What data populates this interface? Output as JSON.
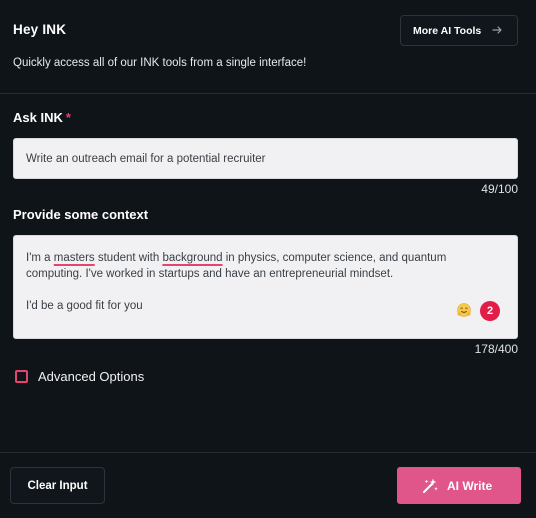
{
  "header": {
    "title": "Hey INK",
    "subtitle": "Quickly access all of our INK tools from a single interface!",
    "more_tools_label": "More AI Tools"
  },
  "ask": {
    "label": "Ask INK",
    "required_marker": "*",
    "value": "Write an outreach email for a potential recruiter",
    "count": "49/100"
  },
  "context": {
    "label": "Provide some context",
    "line1_a": "I'm a ",
    "line1_word1": "masters",
    "line1_b": " student with ",
    "line1_word2": "background",
    "line1_c": " in physics, computer science, and quantum computing. I've worked in startups and have an entrepreneurial mindset.",
    "line2": "I'd be a good fit for you",
    "grammar_issue_count": "2",
    "count": "178/400"
  },
  "advanced": {
    "label": "Advanced Options",
    "checked": false
  },
  "footer": {
    "clear_label": "Clear Input",
    "write_label": "AI Write"
  },
  "colors": {
    "background": "#0f1419",
    "accent": "#e0568a",
    "required": "#e5446d",
    "badge": "#e11d48",
    "input_bg": "#f1f1f3"
  }
}
